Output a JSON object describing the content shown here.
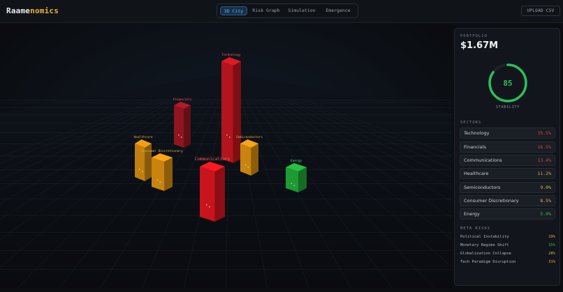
{
  "app": {
    "logo_main": "Raame",
    "logo_accent": "nomics"
  },
  "nav": {
    "tabs": [
      {
        "label": "3D City",
        "active": true
      },
      {
        "label": "Risk Graph",
        "active": false
      },
      {
        "label": "Simulation",
        "active": false
      },
      {
        "label": "Emergence",
        "active": false
      }
    ]
  },
  "toolbar": {
    "upload_label": "UPLOAD CSV"
  },
  "scene": {
    "buildings": [
      {
        "name": "Technology",
        "color": "#b3141d"
      },
      {
        "name": "Financials",
        "color": "#8f1520"
      },
      {
        "name": "Healthcare",
        "color": "#c17f10"
      },
      {
        "name": "Consumer Discretionary",
        "color": "#c9840f"
      },
      {
        "name": "Semiconductors",
        "color": "#c9840f"
      },
      {
        "name": "Communications",
        "color": "#c8141c"
      },
      {
        "name": "Energy",
        "color": "#1e9a32"
      }
    ]
  },
  "panel": {
    "portfolio_label": "PORTFOLIO",
    "portfolio_value": "$1.67M",
    "stability_score": "85",
    "stability_fraction": 0.85,
    "stability_label": "STABILITY",
    "sectors_title": "SECTORS",
    "sectors": [
      {
        "name": "Technology",
        "value": "35.5%",
        "color": "#e0443e"
      },
      {
        "name": "Financials",
        "value": "16.5%",
        "color": "#e0443e"
      },
      {
        "name": "Communications",
        "value": "13.4%",
        "color": "#e0443e"
      },
      {
        "name": "Healthcare",
        "value": "11.2%",
        "color": "#e8b341"
      },
      {
        "name": "Semiconductors",
        "value": "9.0%",
        "color": "#e8b341"
      },
      {
        "name": "Consumer Discretionary",
        "value": "8.5%",
        "color": "#e8b341"
      },
      {
        "name": "Energy",
        "value": "5.9%",
        "color": "#2fc25b"
      }
    ],
    "meta_title": "META RISKS",
    "meta_risks": [
      {
        "name": "Political Instability",
        "value": "19%",
        "color": "#e8b341"
      },
      {
        "name": "Monetary Regime Shift",
        "value": "15%",
        "color": "#2fc25b"
      },
      {
        "name": "Globalization Collapse",
        "value": "28%",
        "color": "#e8b341"
      },
      {
        "name": "Tech Paradigm Disruption",
        "value": "31%",
        "color": "#e8b341"
      }
    ],
    "gauge_color": "#27c25a"
  }
}
